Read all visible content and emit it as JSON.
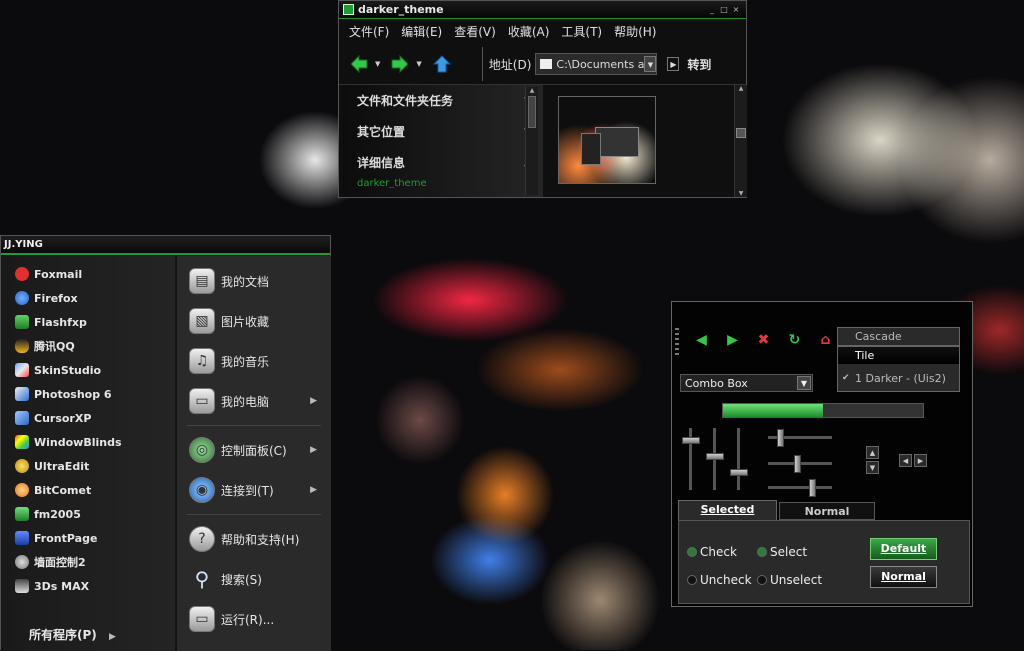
{
  "explorer": {
    "title": "darker_theme",
    "window_controls": [
      "_",
      "□",
      "×"
    ],
    "menu": [
      "文件(F)",
      "编辑(E)",
      "查看(V)",
      "收藏(A)",
      "工具(T)",
      "帮助(H)"
    ],
    "address_label": "地址(D)",
    "address_value": "C:\\Documents an",
    "go_label": "转到",
    "tasks": [
      "文件和文件夹任务",
      "其它位置",
      "详细信息"
    ],
    "detail_text": "darker_theme"
  },
  "start_menu": {
    "user": "JJ.YING",
    "programs": [
      "Foxmail",
      "Firefox",
      "Flashfxp",
      "腾讯QQ",
      "SkinStudio",
      "Photoshop 6",
      "CursorXP",
      "WindowBlinds",
      "UltraEdit",
      "BitComet",
      "fm2005",
      "FrontPage",
      "墙面控制2",
      "3Ds MAX"
    ],
    "all_programs": "所有程序(P)",
    "right_items": [
      "我的文档",
      "图片收藏",
      "我的音乐",
      "我的电脑",
      "控制面板(C)",
      "连接到(T)",
      "帮助和支持(H)",
      "搜索(S)",
      "运行(R)..."
    ],
    "right_icons": [
      "documents-icon",
      "pictures-icon",
      "music-icon",
      "computer-icon",
      "control-panel-icon",
      "connect-icon",
      "help-icon",
      "search-icon",
      "run-icon"
    ]
  },
  "preview": {
    "combo": "Combo Box",
    "menu_items": [
      "Cascade",
      "Tile",
      "1 Darker - (Uis2)"
    ],
    "progress_value": 0.5,
    "tabs": [
      "Selected",
      "Normal"
    ],
    "options": [
      "Check",
      "Select",
      "Uncheck",
      "Unselect"
    ],
    "buttons": [
      "Default",
      "Normal"
    ]
  },
  "colors": {
    "accent_green": "#1c9f2e",
    "panel": "#2a2a2a"
  }
}
